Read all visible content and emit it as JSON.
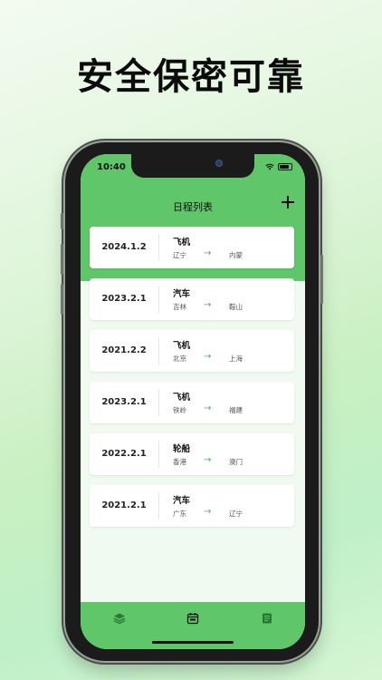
{
  "promo": {
    "headline": "安全保密可靠"
  },
  "status_bar": {
    "time": "10:40"
  },
  "header": {
    "title": "日程列表"
  },
  "trips": [
    {
      "date": "2024.1.2",
      "type": "飞机",
      "from": "辽宁",
      "to": "内蒙"
    },
    {
      "date": "2023.2.1",
      "type": "汽车",
      "from": "吉林",
      "to": "鞍山"
    },
    {
      "date": "2021.2.2",
      "type": "飞机",
      "from": "北京",
      "to": "上海"
    },
    {
      "date": "2023.2.1",
      "type": "飞机",
      "from": "铁岭",
      "to": "福建"
    },
    {
      "date": "2022.2.1",
      "type": "轮船",
      "from": "香港",
      "to": "澳门"
    },
    {
      "date": "2021.2.1",
      "type": "汽车",
      "from": "广东",
      "to": "辽宁"
    }
  ],
  "arrow": "→",
  "tabbar": {
    "items": [
      {
        "icon": "layers-icon"
      },
      {
        "icon": "calendar-icon",
        "selected": true
      },
      {
        "icon": "notes-icon"
      }
    ]
  },
  "colors": {
    "accent": "#5fc66a",
    "arrow": "#49b35a"
  }
}
